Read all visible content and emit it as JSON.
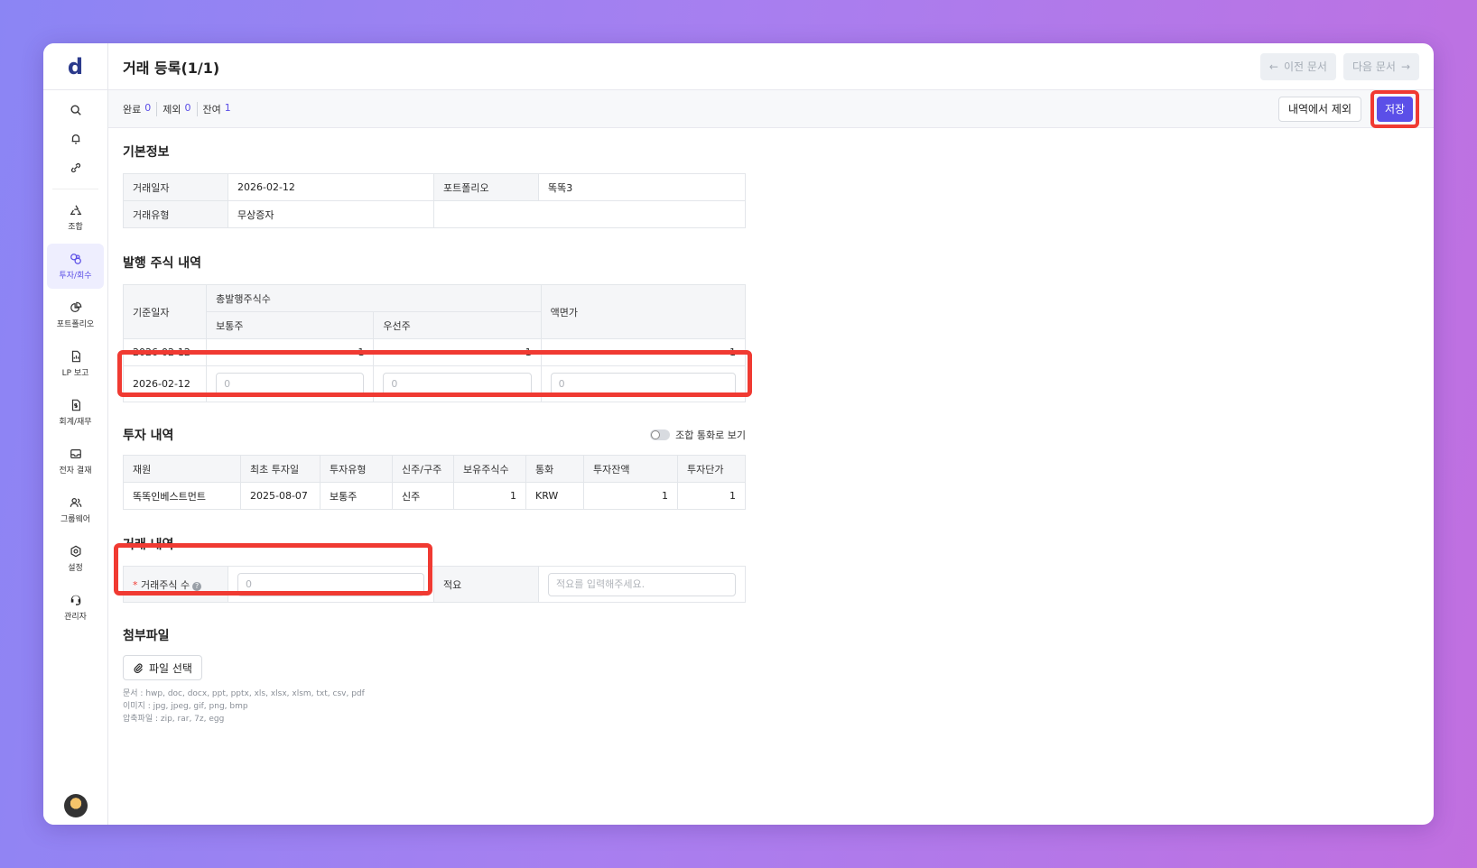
{
  "sidebar": {
    "logo": "d",
    "items": [
      {
        "label": "조합",
        "icon": "recycle-icon"
      },
      {
        "label": "투자/회수",
        "icon": "coins-icon",
        "active": true
      },
      {
        "label": "포트폴리오",
        "icon": "pie-chart-icon"
      },
      {
        "label": "LP 보고",
        "icon": "report-icon"
      },
      {
        "label": "회계/재무",
        "icon": "dollar-doc-icon"
      },
      {
        "label": "전자 결재",
        "icon": "inbox-icon"
      },
      {
        "label": "그룹웨어",
        "icon": "users-icon"
      },
      {
        "label": "설정",
        "icon": "gear-icon"
      },
      {
        "label": "관리자",
        "icon": "headset-icon"
      }
    ]
  },
  "header": {
    "title": "거래 등록(1/1)",
    "prev_label": "이전 문서",
    "next_label": "다음 문서"
  },
  "status": {
    "done_label": "완료",
    "done_count": "0",
    "excluded_label": "제외",
    "excluded_count": "0",
    "remaining_label": "잔여",
    "remaining_count": "1",
    "exclude_button": "내역에서 제외",
    "save_button": "저장"
  },
  "basic_info": {
    "title": "기본정보",
    "date_label": "거래일자",
    "date_value": "2026-02-12",
    "portfolio_label": "포트폴리오",
    "portfolio_value": "똑똑3",
    "type_label": "거래유형",
    "type_value": "무상증자"
  },
  "issued_shares": {
    "title": "발행 주식 내역",
    "base_date_label": "기준일자",
    "total_label": "총발행주식수",
    "common_label": "보통주",
    "preferred_label": "우선주",
    "par_label": "액면가",
    "rows": [
      {
        "date": "2026-02-12",
        "common": "1",
        "preferred": "1",
        "par": "1"
      }
    ],
    "new_row": {
      "date": "2026-02-12",
      "common_placeholder": "0",
      "preferred_placeholder": "0",
      "par_placeholder": "0"
    }
  },
  "investment": {
    "title": "투자 내역",
    "toggle_label": "조합 통화로 보기",
    "headers": [
      "재원",
      "최초 투자일",
      "투자유형",
      "신주/구주",
      "보유주식수",
      "통화",
      "투자잔액",
      "투자단가"
    ],
    "rows": [
      [
        "똑똑인베스트먼트",
        "2025-08-07",
        "보통주",
        "신주",
        "1",
        "KRW",
        "1",
        "1"
      ]
    ]
  },
  "trade": {
    "title": "거래 내역",
    "shares_label": "거래주식 수",
    "shares_placeholder": "0",
    "memo_label": "적요",
    "memo_placeholder": "적요를 입력해주세요."
  },
  "attachments": {
    "title": "첨부파일",
    "button": "파일 선택",
    "hint_docs": "문서 : hwp, doc, docx, ppt, pptx, xls, xlsx, xlsm, txt, csv, pdf",
    "hint_images": "이미지 : jpg, jpeg, gif, png, bmp",
    "hint_archives": "압축파일 : zip, rar, 7z, egg"
  },
  "colors": {
    "accent": "#5b4fe8",
    "highlight": "#f03a32"
  }
}
